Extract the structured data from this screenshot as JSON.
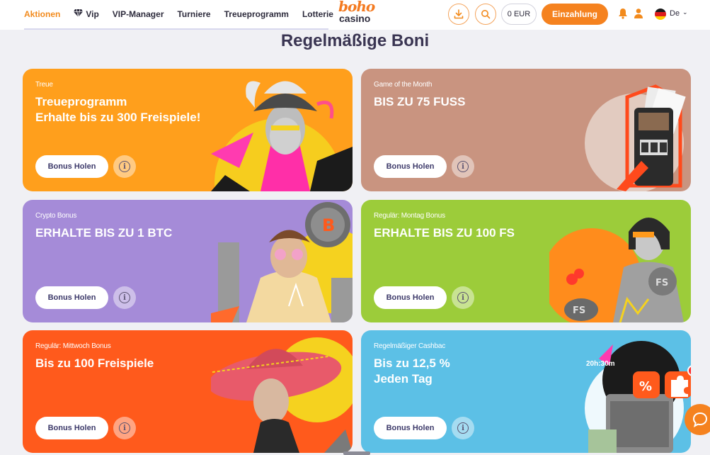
{
  "nav": {
    "items": [
      {
        "label": "Aktionen",
        "active": true
      },
      {
        "label": "Vip",
        "icon": "diamond-icon"
      },
      {
        "label": "VIP-Manager"
      },
      {
        "label": "Turniere"
      },
      {
        "label": "Treueprogramm"
      },
      {
        "label": "Lotterie"
      }
    ]
  },
  "logo": {
    "top": "boho",
    "bottom": "casino"
  },
  "header": {
    "balance": "0 EUR",
    "deposit_label": "Einzahlung",
    "language": "De",
    "download_icon": "download-icon",
    "search_icon": "search-icon"
  },
  "section": {
    "title": "Regelmäßige Boni"
  },
  "cards": [
    {
      "tag": "Treue",
      "title": "Treueprogramm Erhalte bis zu 300 Freispiele!",
      "button": "Bonus Holen",
      "color": "#ff9f1c"
    },
    {
      "tag": "Game of the Month",
      "title": "BIS ZU 75 FUSS",
      "button": "Bonus Holen",
      "color": "#c99480"
    },
    {
      "tag": "Crypto Bonus",
      "title": "ERHALTE BIS ZU 1 BTC",
      "button": "Bonus Holen",
      "color": "#a58bd8"
    },
    {
      "tag": "Regulär: Montag Bonus",
      "title": "ERHALTE BIS ZU 100 FS",
      "button": "Bonus Holen",
      "color": "#9ccc3a"
    },
    {
      "tag": "Regulär: Mittwoch Bonus",
      "title": "Bis zu 100 Freispiele",
      "button": "Bonus Holen",
      "color": "#ff5a1c"
    },
    {
      "tag": "Regelmäßiger Cashbac",
      "title": "Bis zu 12,5 % Jeden Tag",
      "button": "Bonus Holen",
      "color": "#5cc0e6",
      "timer": "20h:30m"
    }
  ],
  "info_symbol": "i"
}
